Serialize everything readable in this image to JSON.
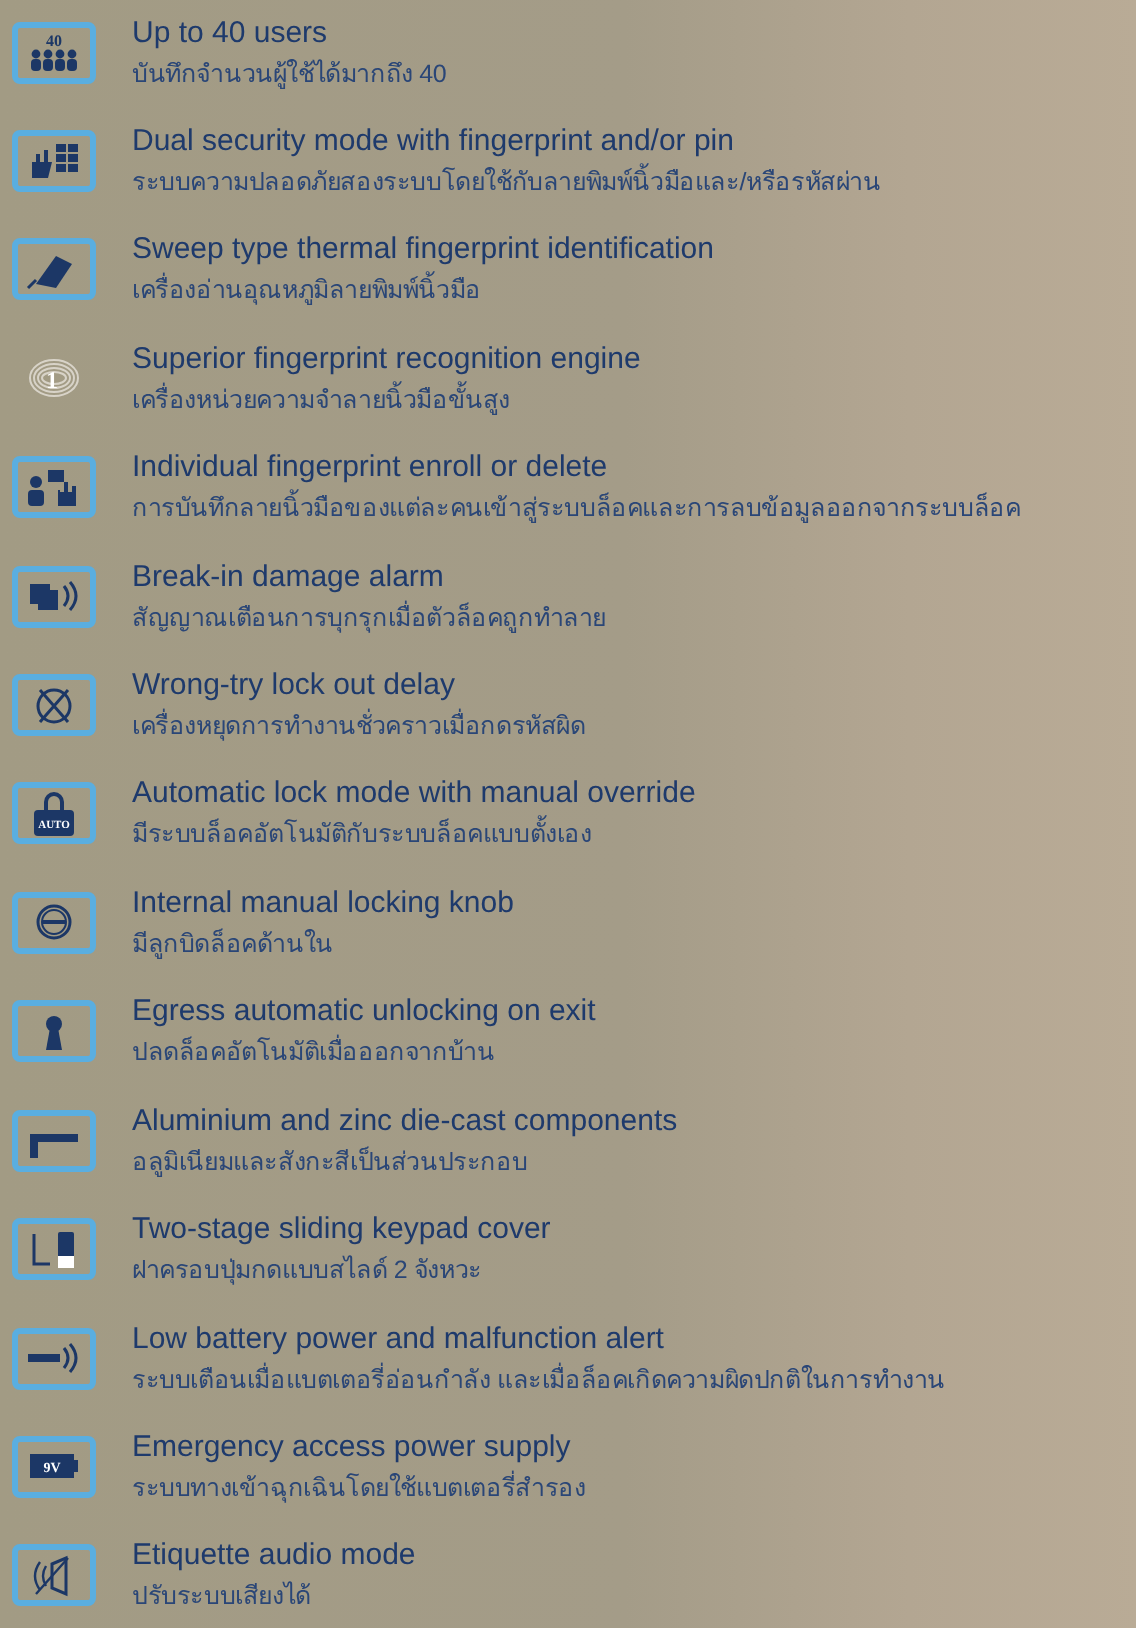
{
  "features": [
    {
      "kind": "users",
      "badge": "40",
      "title": "Up to 40 users",
      "subtitle": "บันทึกจำนวนผู้ใช้ได้มากถึง 40"
    },
    {
      "kind": "pin",
      "title": "Dual security mode with fingerprint and/or pin",
      "subtitle": "ระบบความปลอดภัยสองระบบโดยใช้กับลายพิมพ์นิ้วมือและ/หรือรหัสผ่าน"
    },
    {
      "kind": "sweep",
      "title": "Sweep type thermal fingerprint identification",
      "subtitle": "เครื่องอ่านอุณหภูมิลายพิมพ์นิ้วมือ"
    },
    {
      "kind": "fingerprint",
      "badge": "1",
      "title": "Superior fingerprint recognition engine",
      "subtitle": "เครื่องหน่วยความจำลายนิ้วมือขั้นสูง"
    },
    {
      "kind": "enroll",
      "title": "Individual fingerprint enroll or delete",
      "subtitle": "การบันทึกลายนิ้วมือของแต่ละคนเข้าสู่ระบบล็อคและการลบข้อมูลออกจากระบบล็อค"
    },
    {
      "kind": "alarm",
      "title": "Break-in damage alarm",
      "subtitle": "สัญญาณเตือนการบุกรุกเมื่อตัวล็อคถูกทำลาย"
    },
    {
      "kind": "delay",
      "title": "Wrong-try lock out delay",
      "subtitle": "เครื่องหยุดการทำงานชั่วคราวเมื่อกดรหัสผิด"
    },
    {
      "kind": "auto",
      "badge": "AUTO",
      "title": "Automatic lock mode with manual override",
      "subtitle": "มีระบบล็อคอัตโนมัติกับระบบล็อคแบบตั้งเอง"
    },
    {
      "kind": "knob",
      "title": "Internal manual locking knob",
      "subtitle": "มีลูกบิดล็อคด้านใน"
    },
    {
      "kind": "keyhole",
      "title": "Egress automatic unlocking on exit",
      "subtitle": "ปลดล็อคอัตโนมัติเมื่อออกจากบ้าน"
    },
    {
      "kind": "handle",
      "title": "Aluminium and zinc die-cast components",
      "subtitle": "อลูมิเนียมและสังกะสีเป็นส่วนประกอบ"
    },
    {
      "kind": "slide",
      "title": "Two-stage sliding keypad cover",
      "subtitle": "ฝาครอบปุ่มกดแบบสไลด์ 2 จังหวะ"
    },
    {
      "kind": "signal",
      "title": "Low battery power and malfunction alert",
      "subtitle": "ระบบเตือนเมื่อแบตเตอรี่อ่อนกำลัง และเมื่อล็อคเกิดความผิดปกติในการทำงาน"
    },
    {
      "kind": "battery",
      "badge": "9V",
      "title": "Emergency access power supply",
      "subtitle": "ระบบทางเข้าฉุกเฉินโดยใช้แบตเตอรี่สำรอง"
    },
    {
      "kind": "audio",
      "title": "Etiquette audio mode",
      "subtitle": "ปรับระบบเสียงได้"
    }
  ]
}
